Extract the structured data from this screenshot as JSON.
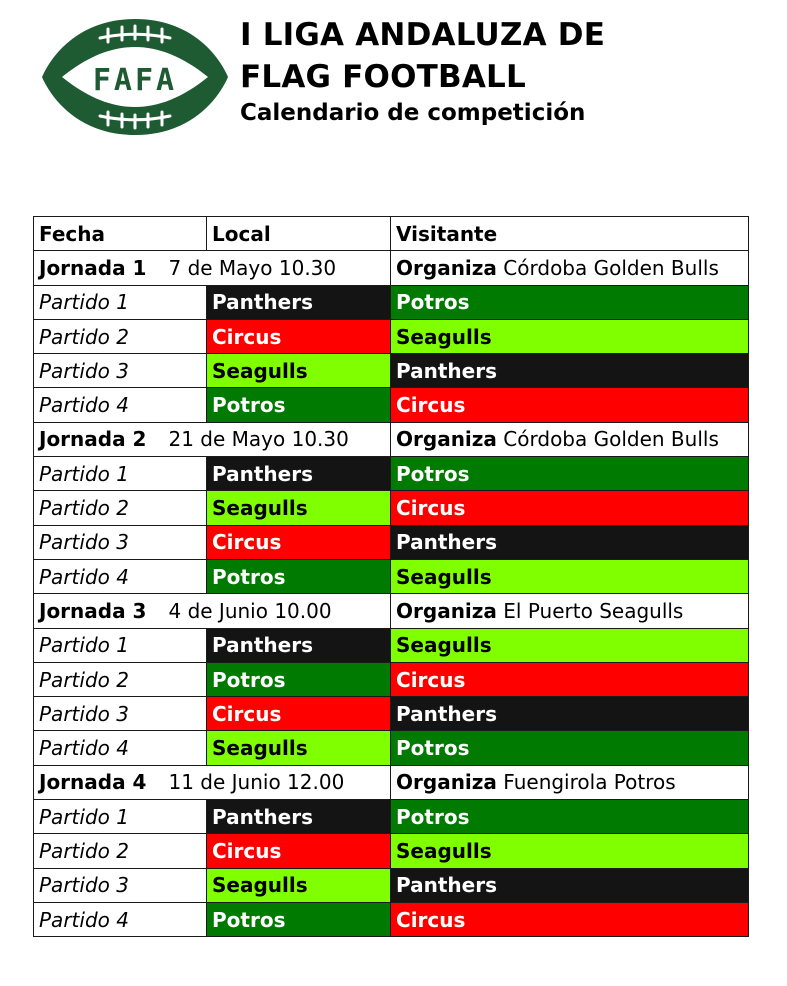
{
  "header": {
    "logo_text": "FAFA",
    "title_line1": "I LIGA ANDALUZA DE",
    "title_line2": "FLAG FOOTBALL",
    "subtitle": "Calendario de competición"
  },
  "colors": {
    "logo_green": "#1e5a32",
    "Panthers": "#141414",
    "Potros": "#007a00",
    "Circus": "#ff0000",
    "Seagulls": "#80ff00"
  },
  "table": {
    "headers": [
      "Fecha",
      "Local",
      "Visitante"
    ],
    "organiza_label": "Organiza",
    "jornadas": [
      {
        "name": "Jornada 1",
        "date": "7 de Mayo  10.30",
        "host": "Córdoba Golden Bulls",
        "matches": [
          {
            "label": "Partido 1",
            "local": "Panthers",
            "visitante": "Potros"
          },
          {
            "label": "Partido 2",
            "local": "Circus",
            "visitante": "Seagulls"
          },
          {
            "label": "Partido 3",
            "local": "Seagulls",
            "visitante": "Panthers"
          },
          {
            "label": "Partido 4",
            "local": "Potros",
            "visitante": "Circus"
          }
        ]
      },
      {
        "name": "Jornada 2",
        "date": "21 de Mayo  10.30",
        "host": "Córdoba Golden Bulls",
        "matches": [
          {
            "label": "Partido 1",
            "local": "Panthers",
            "visitante": "Potros"
          },
          {
            "label": "Partido 2",
            "local": "Seagulls",
            "visitante": "Circus"
          },
          {
            "label": "Partido 3",
            "local": "Circus",
            "visitante": "Panthers"
          },
          {
            "label": "Partido 4",
            "local": "Potros",
            "visitante": "Seagulls"
          }
        ]
      },
      {
        "name": "Jornada 3",
        "date": "4 de Junio  10.00",
        "host": "El Puerto Seagulls",
        "matches": [
          {
            "label": "Partido 1",
            "local": "Panthers",
            "visitante": "Seagulls"
          },
          {
            "label": "Partido 2",
            "local": "Potros",
            "visitante": "Circus"
          },
          {
            "label": "Partido 3",
            "local": "Circus",
            "visitante": "Panthers"
          },
          {
            "label": "Partido 4",
            "local": "Seagulls",
            "visitante": "Potros"
          }
        ]
      },
      {
        "name": "Jornada 4",
        "date": "11 de Junio  12.00",
        "host": "Fuengirola Potros",
        "matches": [
          {
            "label": "Partido 1",
            "local": "Panthers",
            "visitante": "Potros"
          },
          {
            "label": "Partido 2",
            "local": "Circus",
            "visitante": "Seagulls"
          },
          {
            "label": "Partido 3",
            "local": "Seagulls",
            "visitante": "Panthers"
          },
          {
            "label": "Partido 4",
            "local": "Potros",
            "visitante": "Circus"
          }
        ]
      }
    ]
  }
}
